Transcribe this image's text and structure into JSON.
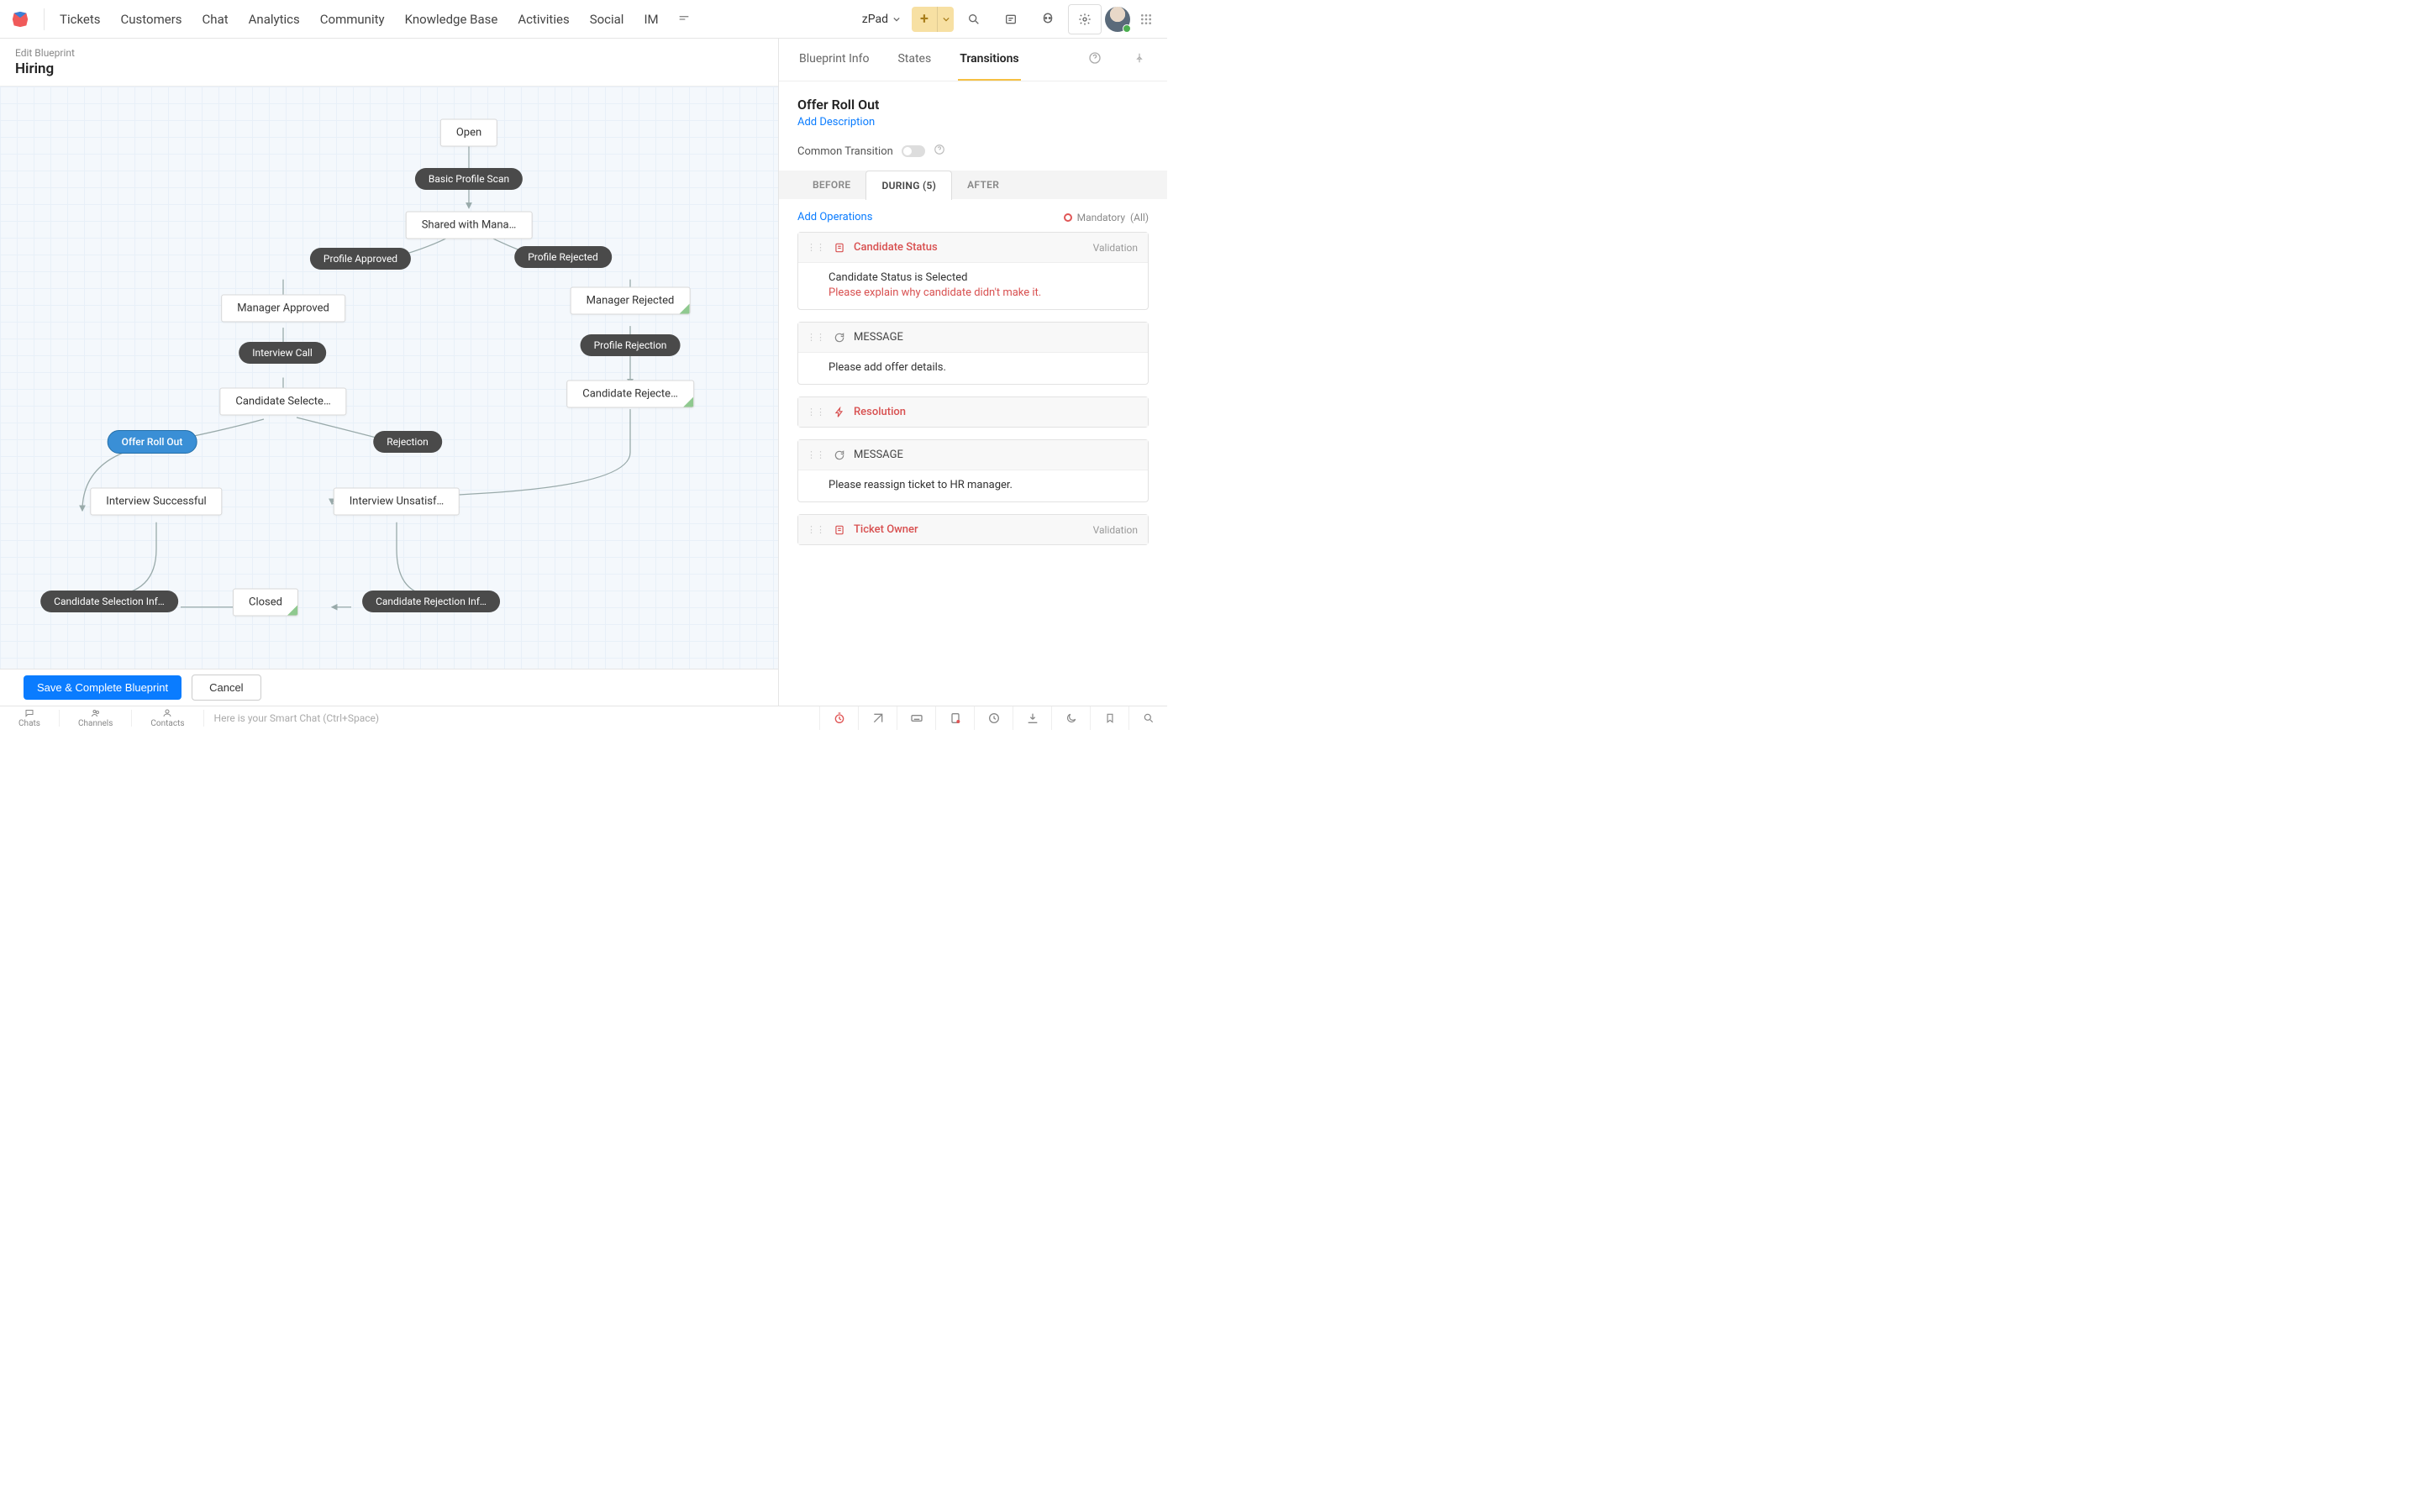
{
  "topnav": {
    "links": [
      "Tickets",
      "Customers",
      "Chat",
      "Analytics",
      "Community",
      "Knowledge Base",
      "Activities",
      "Social",
      "IM"
    ],
    "workspace": "zPad"
  },
  "canvas": {
    "crumb": "Edit Blueprint",
    "title": "Hiring",
    "nodes": {
      "open": "Open",
      "shared": "Shared with Mana…",
      "mgr_approved": "Manager Approved",
      "mgr_rejected": "Manager Rejected",
      "cand_selected": "Candidate Selecte…",
      "cand_rejected": "Candidate Rejecte…",
      "int_success": "Interview Successful",
      "int_unsat": "Interview Unsatisf…",
      "closed": "Closed"
    },
    "pills": {
      "scan": "Basic Profile Scan",
      "p_approved": "Profile Approved",
      "p_rejected": "Profile Rejected",
      "int_call": "Interview Call",
      "p_rej2": "Profile Rejection",
      "offer": "Offer Roll Out",
      "rejection": "Rejection",
      "sel_info": "Candidate Selection Inf…",
      "rej_info": "Candidate Rejection Inf…"
    },
    "footer": {
      "save": "Save & Complete Blueprint",
      "cancel": "Cancel"
    }
  },
  "panel": {
    "tabs": {
      "info": "Blueprint Info",
      "states": "States",
      "transitions": "Transitions"
    },
    "transition": {
      "title": "Offer Roll Out",
      "add_desc": "Add Description"
    },
    "common": "Common Transition",
    "phases": {
      "before": "BEFORE",
      "during": "DURING (5)",
      "after": "AFTER"
    },
    "ops": {
      "add": "Add Operations",
      "mandatory": "Mandatory",
      "mandatory_all": "(All)"
    },
    "items": {
      "cand_status": {
        "title": "Candidate Status",
        "tag": "Validation",
        "line1_pre": "Candidate Status is ",
        "line1_val": "Selected",
        "line2": "Please explain why candidate didn't make it."
      },
      "msg1": {
        "title": "MESSAGE",
        "body": "Please add offer details."
      },
      "resolution": {
        "title": "Resolution"
      },
      "msg2": {
        "title": "MESSAGE",
        "body": "Please reassign ticket to HR manager."
      },
      "ticket_owner": {
        "title": "Ticket Owner",
        "tag": "Validation"
      }
    }
  },
  "bottombar": {
    "chats": "Chats",
    "channels": "Channels",
    "contacts": "Contacts",
    "smartchat": "Here is your Smart Chat (Ctrl+Space)"
  }
}
